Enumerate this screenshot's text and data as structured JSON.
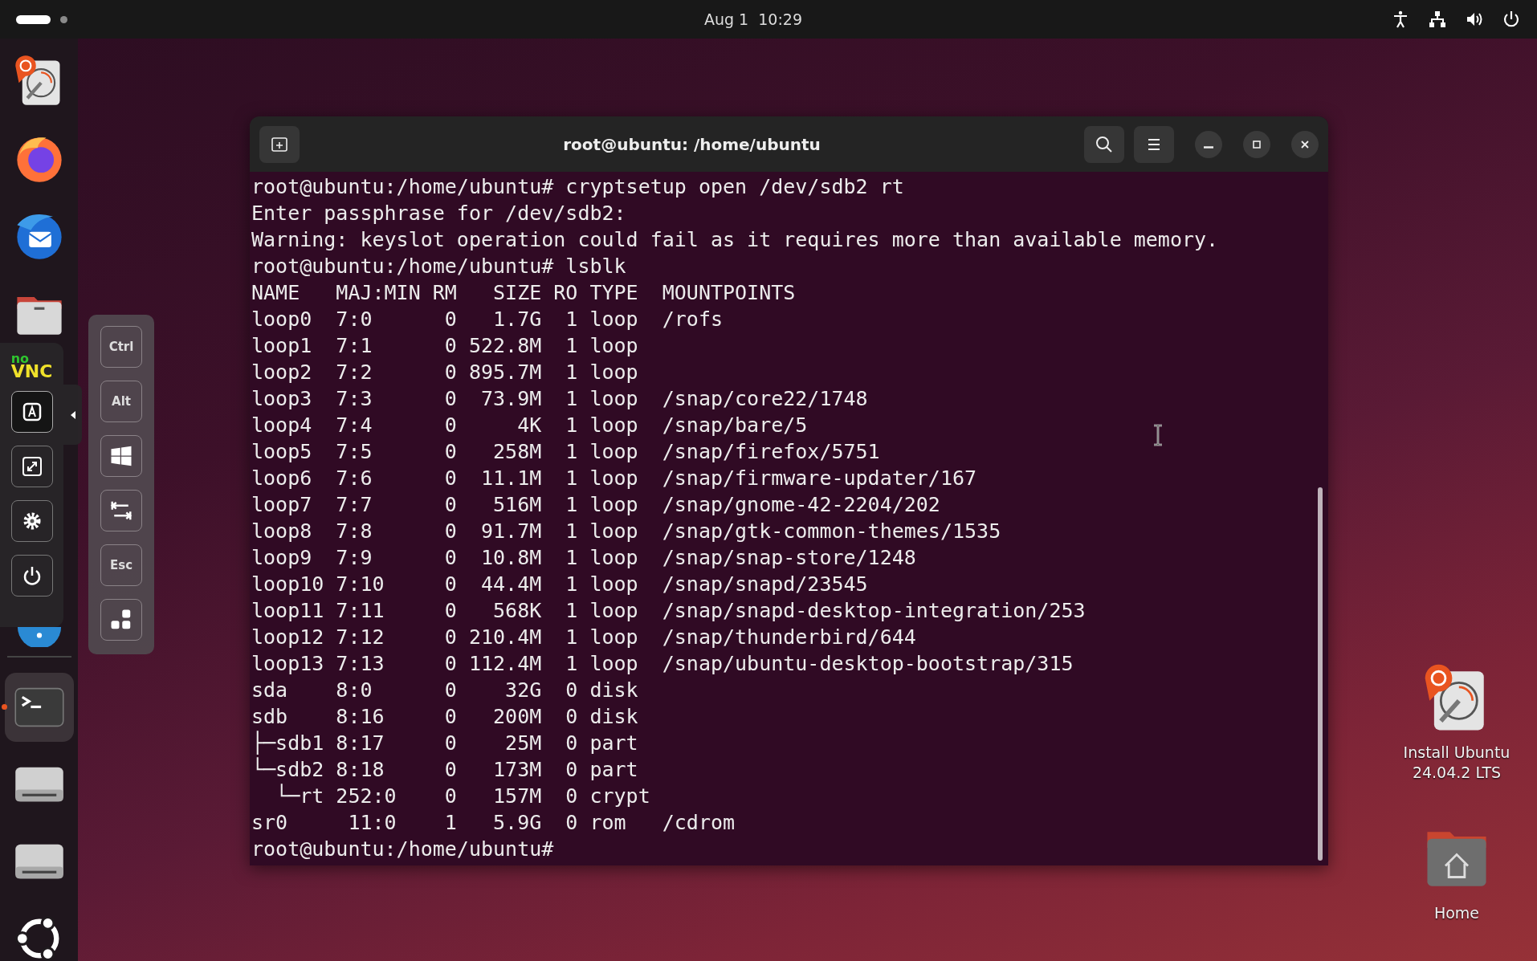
{
  "top_bar": {
    "clock": "Aug 1  10:29"
  },
  "dock": {
    "items": [
      {
        "kind": "installer",
        "running": false
      },
      {
        "kind": "firefox",
        "running": false
      },
      {
        "kind": "thunderbird",
        "running": false
      },
      {
        "kind": "files",
        "running": false
      },
      {
        "kind": "help",
        "running": false
      },
      {
        "kind": "terminal",
        "running": true
      },
      {
        "kind": "drive",
        "running": false
      },
      {
        "kind": "drive",
        "running": false
      },
      {
        "kind": "apps",
        "running": false
      }
    ]
  },
  "novnc_panel": {
    "logo_top": "no",
    "logo_bottom": "VNC",
    "buttons": [
      {
        "kind": "keyboard",
        "selected": true
      },
      {
        "kind": "fullscreen",
        "selected": false
      },
      {
        "kind": "settings",
        "selected": false
      },
      {
        "kind": "power",
        "selected": false
      }
    ]
  },
  "extra_keys": [
    {
      "kind": "text",
      "label": "Ctrl"
    },
    {
      "kind": "text",
      "label": "Alt"
    },
    {
      "kind": "windows"
    },
    {
      "kind": "tab"
    },
    {
      "kind": "text",
      "label": "Esc"
    },
    {
      "kind": "more"
    }
  ],
  "terminal": {
    "title": "root@ubuntu: /home/ubuntu",
    "lines": [
      "root@ubuntu:/home/ubuntu# cryptsetup open /dev/sdb2 rt",
      "Enter passphrase for /dev/sdb2:",
      "Warning: keyslot operation could fail as it requires more than available memory.",
      "root@ubuntu:/home/ubuntu# lsblk",
      "NAME   MAJ:MIN RM   SIZE RO TYPE  MOUNTPOINTS",
      "loop0  7:0      0   1.7G  1 loop  /rofs",
      "loop1  7:1      0 522.8M  1 loop",
      "loop2  7:2      0 895.7M  1 loop",
      "loop3  7:3      0  73.9M  1 loop  /snap/core22/1748",
      "loop4  7:4      0     4K  1 loop  /snap/bare/5",
      "loop5  7:5      0   258M  1 loop  /snap/firefox/5751",
      "loop6  7:6      0  11.1M  1 loop  /snap/firmware-updater/167",
      "loop7  7:7      0   516M  1 loop  /snap/gnome-42-2204/202",
      "loop8  7:8      0  91.7M  1 loop  /snap/gtk-common-themes/1535",
      "loop9  7:9      0  10.8M  1 loop  /snap/snap-store/1248",
      "loop10 7:10     0  44.4M  1 loop  /snap/snapd/23545",
      "loop11 7:11     0   568K  1 loop  /snap/snapd-desktop-integration/253",
      "loop12 7:12     0 210.4M  1 loop  /snap/thunderbird/644",
      "loop13 7:13     0 112.4M  1 loop  /snap/ubuntu-desktop-bootstrap/315",
      "sda    8:0      0    32G  0 disk",
      "sdb    8:16     0   200M  0 disk",
      "├─sdb1 8:17     0    25M  0 part",
      "└─sdb2 8:18     0   173M  0 part",
      "  └─rt 252:0    0   157M  0 crypt",
      "sr0     11:0    1   5.9G  0 rom   /cdrom",
      "root@ubuntu:/home/ubuntu#"
    ]
  },
  "desktop_icons": [
    {
      "kind": "installer",
      "label": "Install Ubuntu 24.04.2 LTS"
    },
    {
      "kind": "home",
      "label": "Home"
    }
  ]
}
